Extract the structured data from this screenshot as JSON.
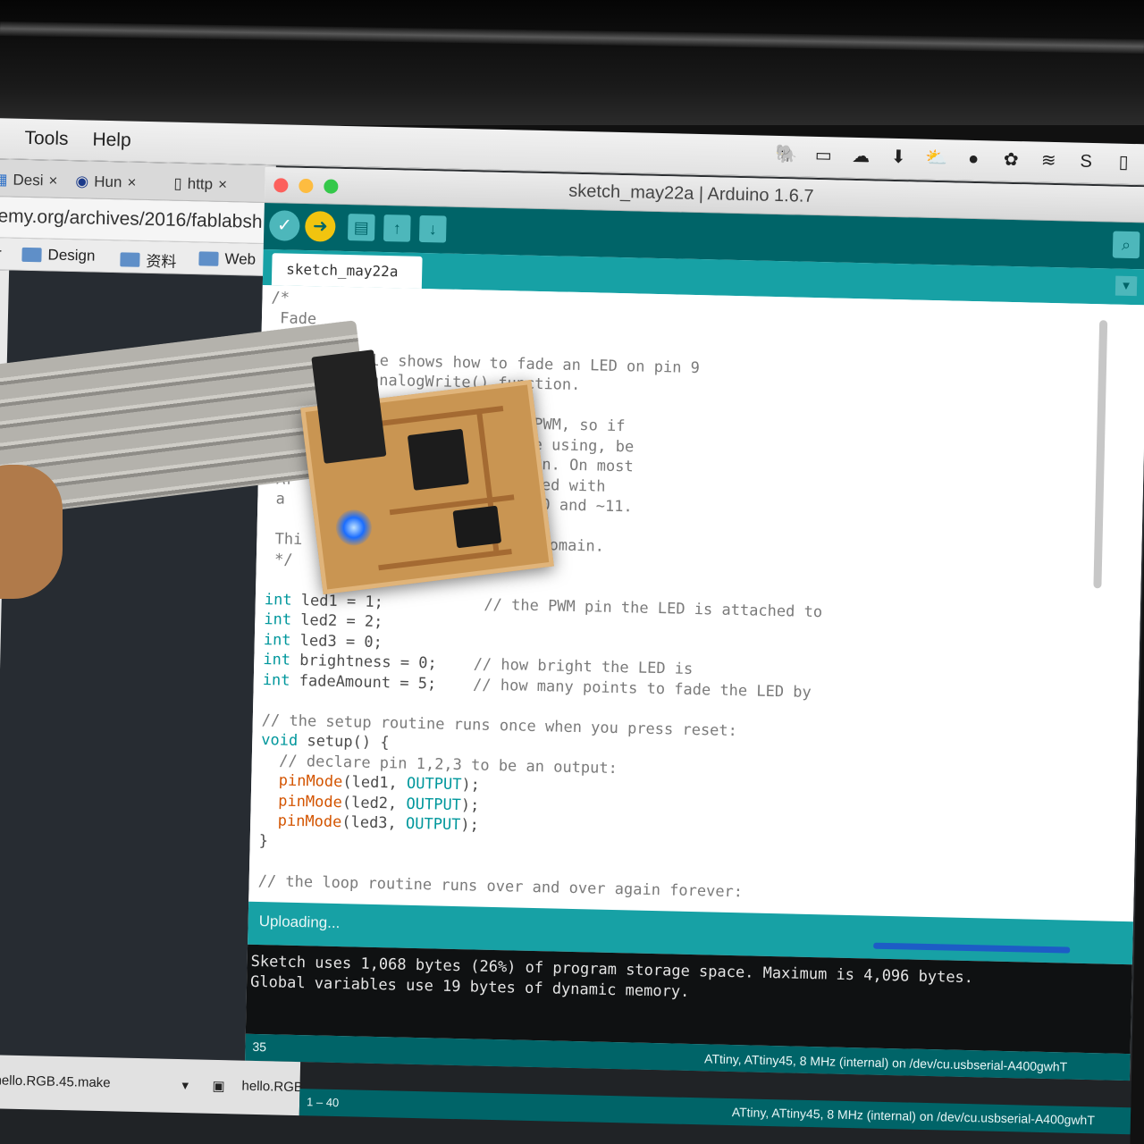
{
  "menubar": {
    "items": [
      "Tools",
      "Help"
    ]
  },
  "browser": {
    "tabs": [
      "Desi",
      "Hun",
      "http"
    ],
    "address": "emy.org/archives/2016/fablabsh",
    "bookmarks": [
      "er",
      "Design",
      "资料",
      "Web"
    ]
  },
  "arduino": {
    "title": "sketch_may22a | Arduino 1.6.7",
    "tab_label": "sketch_may22a",
    "code_lines": [
      {
        "text": "/*",
        "cls": "cm"
      },
      {
        "text": " Fade",
        "cls": "cm"
      },
      {
        "text": "",
        "cls": "cm"
      },
      {
        "text": " This example shows how to fade an LED on pin 9",
        "cls": "cm"
      },
      {
        "text": " using the analogWrite() function.",
        "cls": "cm"
      },
      {
        "text": "",
        "cls": "cm"
      },
      {
        "text": "                        uses PWM, so if",
        "cls": "cm"
      },
      {
        "text": "                        you're using, be",
        "cls": "cm"
      },
      {
        "text": "                        ble pin. On most",
        "cls": "cm"
      },
      {
        "text": " Ar                     entified with",
        "cls": "cm"
      },
      {
        "text": " a                      ~9, ~10 and ~11.",
        "cls": "cm"
      },
      {
        "text": "",
        "cls": "cm"
      },
      {
        "text": " Thi                    ublic domain.",
        "cls": "cm"
      },
      {
        "text": " */",
        "cls": "cm"
      },
      {
        "text": "",
        "cls": ""
      },
      {
        "text": "int led1 = 1;           // the PWM pin the LED is attached to",
        "cls": "code"
      },
      {
        "text": "int led2 = 2;",
        "cls": "code"
      },
      {
        "text": "int led3 = 0;",
        "cls": "code"
      },
      {
        "text": "int brightness = 0;    // how bright the LED is",
        "cls": "code"
      },
      {
        "text": "int fadeAmount = 5;    // how many points to fade the LED by",
        "cls": "code"
      },
      {
        "text": "",
        "cls": ""
      },
      {
        "text": "// the setup routine runs once when you press reset:",
        "cls": "cm"
      },
      {
        "text": "void setup() {",
        "cls": "code"
      },
      {
        "text": "  // declare pin 1,2,3 to be an output:",
        "cls": "cm"
      },
      {
        "text": "  pinMode(led1, OUTPUT);",
        "cls": "code"
      },
      {
        "text": "  pinMode(led2, OUTPUT);",
        "cls": "code"
      },
      {
        "text": "  pinMode(led3, OUTPUT);",
        "cls": "code"
      },
      {
        "text": "}",
        "cls": "code"
      },
      {
        "text": "",
        "cls": ""
      },
      {
        "text": "// the loop routine runs over and over again forever:",
        "cls": "cm"
      }
    ],
    "status": "Uploading...",
    "console": [
      "Sketch uses 1,068 bytes (26%) of program storage space. Maximum is 4,096 bytes.",
      "Global variables use 19 bytes of dynamic memory."
    ],
    "line_number": "35",
    "board": "ATtiny, ATtiny45, 8 MHz (internal) on /dev/cu.usbserial-A400gwhT"
  },
  "lower": {
    "file1": "hello.RGB.45.make",
    "file2": "hello.RGB",
    "range": "1 – 40",
    "board": "ATtiny, ATtiny45, 8 MHz (internal) on /dev/cu.usbserial-A400gwhT"
  },
  "colors": {
    "arduino_dark_teal": "#006468",
    "arduino_teal": "#17a1a5",
    "upload_button": "#f1c40f",
    "led_blue": "#1a6dff"
  }
}
